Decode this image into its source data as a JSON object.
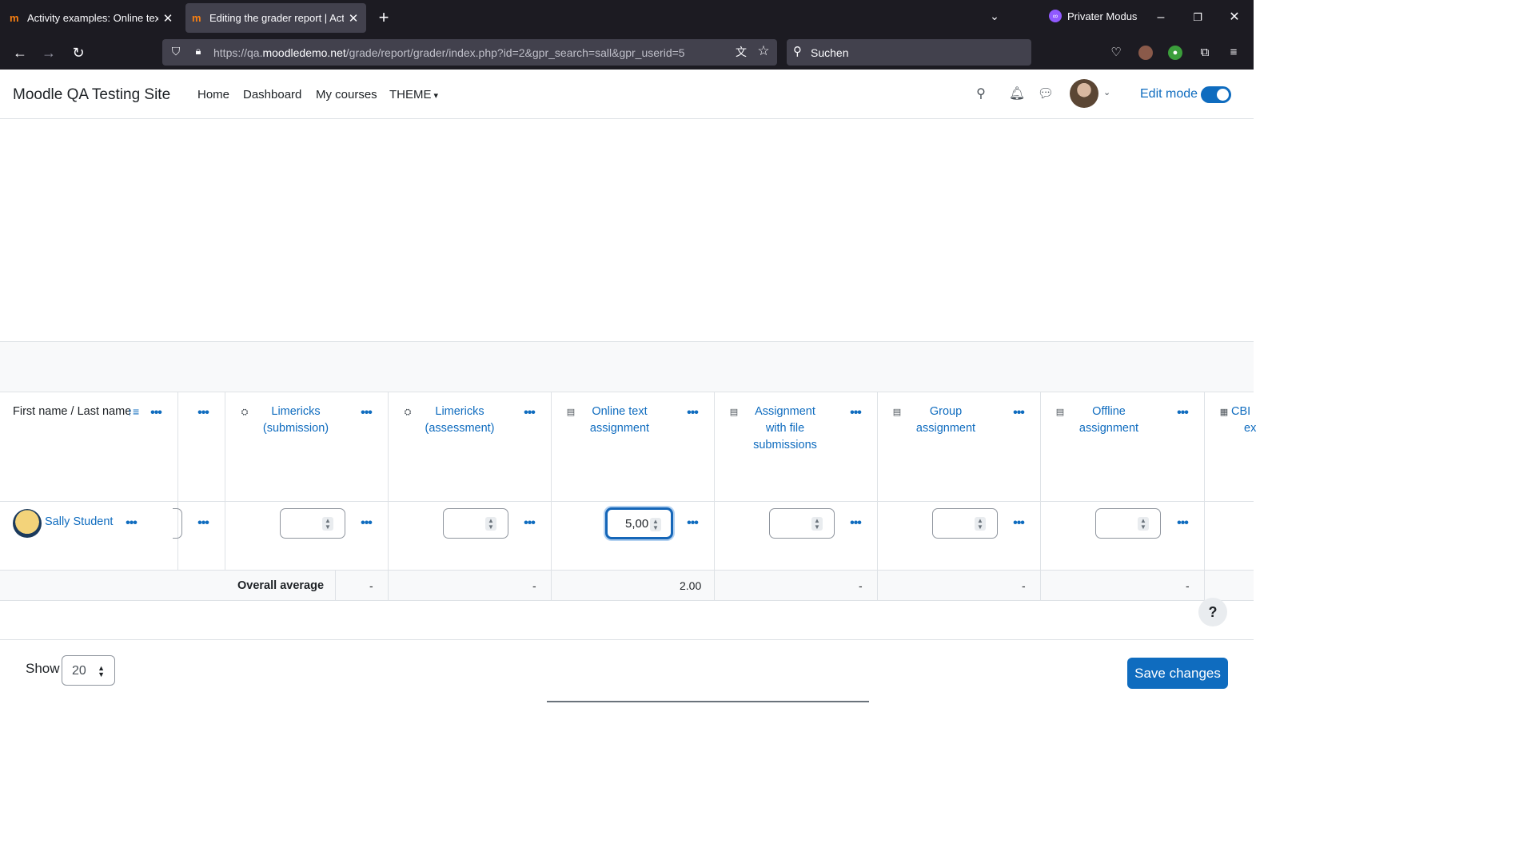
{
  "browser": {
    "tabs": [
      {
        "title": "Activity examples: Online text and",
        "favicon": "moodle-icon"
      },
      {
        "title": "Editing the grader report | Activit",
        "favicon": "moodle-icon",
        "active": true
      }
    ],
    "private_mode_label": "Privater Modus",
    "url_prefix": "https://qa.",
    "url_domain": "moodledemo.net",
    "url_path": "/grade/report/grader/index.php?id=2&gpr_search=sall&gpr_userid=5",
    "search_placeholder": "Suchen"
  },
  "site": {
    "name": "Moodle QA Testing Site",
    "nav": [
      "Home",
      "Dashboard",
      "My courses",
      "THEME"
    ],
    "edit_mode_label": "Edit mode",
    "edit_mode_on": true
  },
  "grader": {
    "name_header": "First name / Last name",
    "columns": [
      {
        "line1": "Limericks",
        "line2": "(submission)",
        "line3": "",
        "icon": "workshop-icon"
      },
      {
        "line1": "Limericks",
        "line2": "(assessment)",
        "line3": "",
        "icon": "workshop-icon"
      },
      {
        "line1": "Online text",
        "line2": "assignment",
        "line3": "",
        "icon": "assignment-icon"
      },
      {
        "line1": "Assignment",
        "line2": "with file",
        "line3": "submissions",
        "icon": "assignment-icon"
      },
      {
        "line1": "Group",
        "line2": "assignment",
        "line3": "",
        "icon": "assignment-icon"
      },
      {
        "line1": "Offline",
        "line2": "assignment",
        "line3": "",
        "icon": "assignment-icon"
      },
      {
        "line1": "CBI",
        "line2": "ex",
        "line3": "",
        "icon": "calculator-icon"
      }
    ],
    "student": {
      "name": "Sally Student",
      "grades": [
        "",
        "",
        "5,00",
        "",
        "",
        ""
      ]
    },
    "overall_average_label": "Overall average",
    "averages": [
      "-",
      "-",
      "2.00",
      "-",
      "-",
      "-"
    ]
  },
  "footer": {
    "show_label": "Show",
    "show_value": "20",
    "save_label": "Save changes"
  },
  "help_label": "?"
}
